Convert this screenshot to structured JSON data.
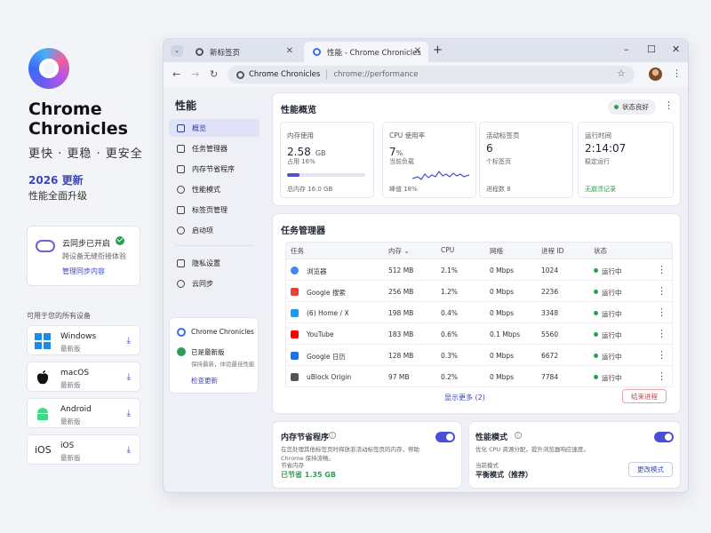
{
  "promo": {
    "brand_line1": "Chrome",
    "brand_line2": "Chronicles",
    "tagline": "更快 · 更稳 · 更安全",
    "update_year": "2026 更新",
    "update_sub": "性能全面升级",
    "sync": {
      "title": "云同步已开启",
      "sub": "跨设备无缝衔接体验",
      "link": "管理同步内容"
    },
    "devices_heading": "可用于您的所有设备",
    "devices": [
      {
        "name": "Windows",
        "version": "最新版",
        "icon": "windows-icon"
      },
      {
        "name": "macOS",
        "version": "最新版",
        "icon": "apple-icon"
      },
      {
        "name": "Android",
        "version": "最新版",
        "icon": "android-icon"
      },
      {
        "name": "iOS",
        "version": "最新版",
        "icon": "ios-icon",
        "icon_text": "iOS"
      }
    ]
  },
  "browser": {
    "tabs": [
      {
        "title": "新标签页",
        "active": false
      },
      {
        "title": "性能 - Chrome Chronicles",
        "active": true
      }
    ],
    "new_tab_glyph": "+",
    "window_controls": [
      "–",
      "☐",
      "✕"
    ],
    "site_name": "Chrome Chronicles",
    "url": "chrome://performance"
  },
  "sidebar": {
    "title": "性能",
    "items": [
      {
        "label": "概览",
        "selected": true
      },
      {
        "label": "任务管理器"
      },
      {
        "label": "内存节省程序"
      },
      {
        "label": "性能模式"
      },
      {
        "label": "标签页管理"
      },
      {
        "label": "启动项"
      },
      {
        "label": "隐私设置"
      },
      {
        "label": "云同步"
      }
    ],
    "card": {
      "title": "Chrome Chronicles",
      "status": "已是最新版",
      "sub": "保持最新，体验最佳性能",
      "link": "检查更新"
    }
  },
  "overview": {
    "title": "性能概览",
    "status_pill": "状态良好",
    "stats": [
      {
        "label": "内存使用",
        "value": "2.58",
        "unit": "GB",
        "sub": "占用 16%",
        "footer": "总内存 16.0 GB",
        "progress": 0.16
      },
      {
        "label": "CPU 使用率",
        "value": "7",
        "unit": "%",
        "sub": "当前负载",
        "footer": "峰值 18%"
      },
      {
        "label": "活动标签页",
        "value": "6",
        "unit": "",
        "sub": "个标签页",
        "footer": "进程数 8"
      },
      {
        "label": "运行时间",
        "value": "2:14:07",
        "unit": "",
        "sub": "稳定运行",
        "footer": "无崩溃记录"
      }
    ]
  },
  "task_manager": {
    "title": "任务管理器",
    "columns": [
      "任务",
      "内存",
      "CPU",
      "网络",
      "进程 ID",
      "状态"
    ],
    "rows": [
      {
        "task": "浏览器",
        "icon": "chrome-icon",
        "mem": "512 MB",
        "cpu": "2.1%",
        "net": "0 Mbps",
        "pid": "1024",
        "status": "运行中"
      },
      {
        "task": "Google 搜索",
        "icon": "google-icon",
        "mem": "256 MB",
        "cpu": "1.2%",
        "net": "0 Mbps",
        "pid": "2236",
        "status": "运行中"
      },
      {
        "task": "(6) Home / X",
        "icon": "twitter-icon",
        "mem": "198 MB",
        "cpu": "0.4%",
        "net": "0 Mbps",
        "pid": "3348",
        "status": "运行中"
      },
      {
        "task": "YouTube",
        "icon": "youtube-icon",
        "mem": "183 MB",
        "cpu": "0.6%",
        "net": "0.1 Mbps",
        "pid": "5560",
        "status": "运行中"
      },
      {
        "task": "Google 日历",
        "icon": "calendar-icon",
        "mem": "128 MB",
        "cpu": "0.3%",
        "net": "0 Mbps",
        "pid": "6672",
        "status": "运行中"
      },
      {
        "task": "uBlock Origin",
        "icon": "puzzle-icon",
        "mem": "97 MB",
        "cpu": "0.2%",
        "net": "0 Mbps",
        "pid": "7784",
        "status": "运行中"
      }
    ],
    "show_more": "显示更多 (2)",
    "end_process": "结束进程"
  },
  "memory_saver": {
    "title": "内存节省程序",
    "desc": "在您处理其他标签页时释放非活动标签页的内存，帮助 Chrome 保持流畅。",
    "saved_label": "节省内存",
    "saved_value": "已节省 1.35 GB",
    "enabled": true
  },
  "perf_mode": {
    "title": "性能模式",
    "desc": "优化 CPU 资源分配，提升浏览器响应速度。",
    "mode_label": "当前模式",
    "mode_value": "平衡模式（推荐）",
    "button": "更改模式",
    "enabled": true
  },
  "colors": {
    "accent": "#4b4fd6",
    "link": "#3b45c4",
    "success": "#2e9e55",
    "danger": "#cc4444"
  }
}
